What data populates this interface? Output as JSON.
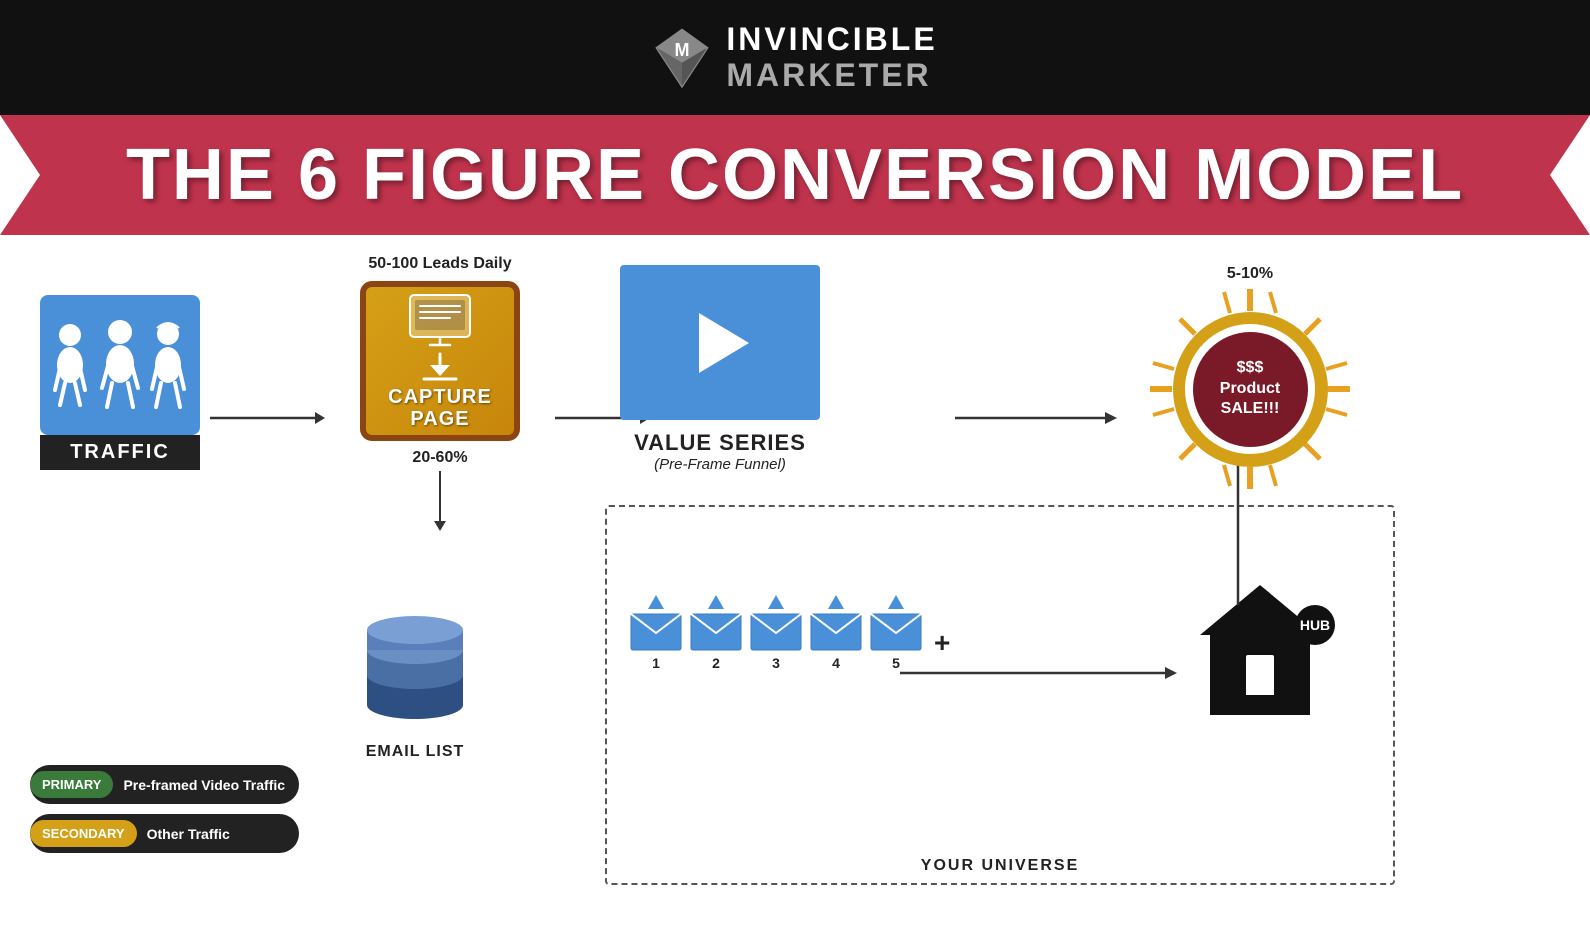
{
  "header": {
    "brand_name": "INVINCIBLE",
    "brand_name2": "MARKETER"
  },
  "banner": {
    "title": "THE 6 FIGURE CONVERSION MODEL"
  },
  "flow": {
    "traffic_label": "TRAFFIC",
    "leads_label": "50-100 Leads Daily",
    "capture_page_line1": "CAPTURE",
    "capture_page_line2": "PAGE",
    "percent_20_60": "20-60%",
    "email_list_label": "EMAIL LIST",
    "value_series_label": "VALUE SERIES",
    "pre_frame_label": "(Pre-Frame Funnel)",
    "email_numbers": [
      "1",
      "2",
      "3",
      "4",
      "5"
    ],
    "hub_label": "HUB",
    "your_universe_label": "YOUR UNIVERSE",
    "product_sale_text": "$$$\nProduct\nSALE!!!",
    "percent_5_10": "5-10%",
    "plus_sign": "+"
  },
  "legend": {
    "primary_label": "PRIMARY",
    "primary_text": "Pre-framed Video Traffic",
    "secondary_label": "SECONDARY",
    "secondary_text": "Other Traffic"
  }
}
